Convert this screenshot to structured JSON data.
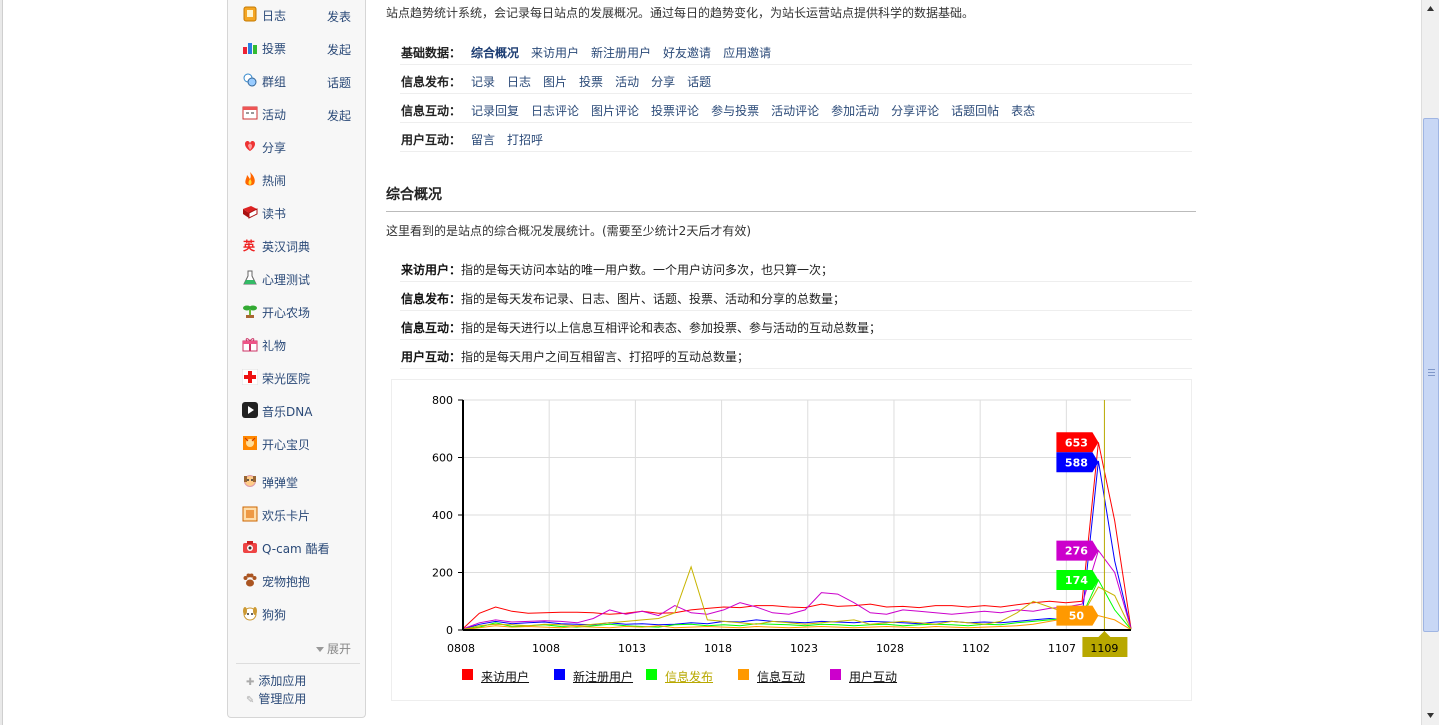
{
  "sidebar": {
    "items": [
      {
        "label": "日志",
        "action": "发表",
        "icon": "diary-icon"
      },
      {
        "label": "投票",
        "action": "发起",
        "icon": "vote-icon"
      },
      {
        "label": "群组",
        "action": "话题",
        "icon": "group-icon"
      },
      {
        "label": "活动",
        "action": "发起",
        "icon": "event-icon"
      },
      {
        "label": "分享",
        "action": "",
        "icon": "share-heart-icon"
      },
      {
        "label": "热闹",
        "action": "",
        "icon": "fire-icon"
      },
      {
        "label": "读书",
        "action": "",
        "icon": "book-icon"
      },
      {
        "label": "英汉词典",
        "action": "",
        "icon": "dictionary-icon"
      },
      {
        "label": "心理测试",
        "action": "",
        "icon": "flask-icon"
      },
      {
        "label": "开心农场",
        "action": "",
        "icon": "sprout-icon"
      },
      {
        "label": "礼物",
        "action": "",
        "icon": "gift-icon"
      },
      {
        "label": "荣光医院",
        "action": "",
        "icon": "hospital-cross-icon"
      },
      {
        "label": "音乐DNA",
        "action": "",
        "icon": "music-play-icon"
      },
      {
        "label": "开心宝贝",
        "action": "",
        "icon": "baby-icon"
      },
      {
        "label": "弹弹堂",
        "action": "",
        "icon": "dog-face-icon"
      },
      {
        "label": "欢乐卡片",
        "action": "",
        "icon": "card-icon"
      },
      {
        "label": "Q-cam 酷看",
        "action": "",
        "icon": "camera-icon"
      },
      {
        "label": "宠物抱抱",
        "action": "",
        "icon": "paw-icon"
      },
      {
        "label": "狗狗",
        "action": "",
        "icon": "puppy-icon"
      }
    ],
    "expand_label": "展开",
    "add_app": "添加应用",
    "manage_app": "管理应用"
  },
  "intro_text": "站点趋势统计系统，会记录每日站点的发展概况。通过每日的趋势变化，为站长运营站点提供科学的数据基础。",
  "nav_rows": [
    {
      "label": "基础数据：",
      "links": [
        "综合概况",
        "来访用户",
        "新注册用户",
        "好友邀请",
        "应用邀请"
      ]
    },
    {
      "label": "信息发布：",
      "links": [
        "记录",
        "日志",
        "图片",
        "投票",
        "活动",
        "分享",
        "话题"
      ]
    },
    {
      "label": "信息互动：",
      "links": [
        "记录回复",
        "日志评论",
        "图片评论",
        "投票评论",
        "参与投票",
        "活动评论",
        "参加活动",
        "分享评论",
        "话题回帖",
        "表态"
      ]
    },
    {
      "label": "用户互动：",
      "links": [
        "留言",
        "打招呼"
      ]
    }
  ],
  "section": {
    "title": "综合概况",
    "desc": "这里看到的是站点的综合概况发展统计。(需要至少统计2天后才有效)"
  },
  "definitions": [
    {
      "term": "来访用户：",
      "text": "指的是每天访问本站的唯一用户数。一个用户访问多次，也只算一次；"
    },
    {
      "term": "信息发布：",
      "text": "指的是每天发布记录、日志、图片、话题、投票、活动和分享的总数量；"
    },
    {
      "term": "信息互动：",
      "text": "指的是每天进行以上信息互相评论和表态、参加投票、参与活动的互动总数量；"
    },
    {
      "term": "用户互动：",
      "text": "指的是每天用户之间互相留言、打招呼的互动总数量；"
    }
  ],
  "chart_data": {
    "type": "line",
    "ylim": [
      0,
      800
    ],
    "yticks": [
      0,
      200,
      400,
      600,
      800
    ],
    "x_tick_labels": [
      "0808",
      "1008",
      "1013",
      "1018",
      "1023",
      "1028",
      "1102",
      "1107",
      "1109"
    ],
    "highlight_x_label": "1109",
    "grid": true,
    "legend_position": "bottom",
    "series": [
      {
        "name": "来访用户",
        "color": "#ff0000",
        "values": [
          5,
          58,
          80,
          65,
          58,
          60,
          62,
          62,
          60,
          55,
          58,
          65,
          58,
          60,
          70,
          75,
          80,
          78,
          85,
          85,
          80,
          78,
          90,
          82,
          85,
          90,
          80,
          82,
          78,
          85,
          85,
          80,
          85,
          80,
          88,
          95,
          100,
          95,
          100,
          653,
          380,
          5
        ]
      },
      {
        "name": "新注册用户",
        "color": "#0000ff",
        "values": [
          3,
          20,
          30,
          22,
          25,
          28,
          22,
          20,
          18,
          25,
          20,
          22,
          18,
          20,
          25,
          22,
          30,
          28,
          35,
          30,
          28,
          25,
          30,
          28,
          25,
          30,
          28,
          25,
          22,
          28,
          30,
          25,
          28,
          25,
          30,
          35,
          40,
          35,
          45,
          588,
          240,
          3
        ]
      },
      {
        "name": "信息发布",
        "color": "#00ff00",
        "values": [
          2,
          10,
          25,
          12,
          15,
          18,
          12,
          10,
          15,
          20,
          15,
          12,
          10,
          18,
          20,
          15,
          18,
          15,
          22,
          20,
          18,
          15,
          20,
          18,
          15,
          18,
          20,
          15,
          18,
          20,
          18,
          15,
          20,
          18,
          25,
          30,
          35,
          40,
          50,
          174,
          70,
          2
        ]
      },
      {
        "name": "信息互动",
        "color": "#ff9900",
        "values": [
          1,
          8,
          15,
          10,
          12,
          10,
          8,
          12,
          10,
          8,
          12,
          10,
          15,
          8,
          10,
          12,
          10,
          8,
          12,
          10,
          8,
          10,
          12,
          10,
          8,
          10,
          12,
          10,
          8,
          12,
          10,
          8,
          10,
          12,
          15,
          20,
          30,
          40,
          45,
          50,
          35,
          1
        ]
      },
      {
        "name": "用户互动",
        "color": "#cc00cc",
        "values": [
          4,
          25,
          35,
          28,
          30,
          32,
          30,
          25,
          40,
          70,
          55,
          65,
          50,
          85,
          60,
          55,
          70,
          95,
          80,
          60,
          55,
          70,
          130,
          125,
          95,
          60,
          55,
          70,
          65,
          60,
          55,
          60,
          65,
          60,
          70,
          65,
          75,
          80,
          90,
          276,
          200,
          4
        ]
      },
      {
        "name": "",
        "color": "#c8b400",
        "values": [
          2,
          15,
          20,
          18,
          15,
          20,
          18,
          15,
          20,
          25,
          30,
          35,
          40,
          60,
          220,
          35,
          30,
          25,
          20,
          30,
          25,
          20,
          25,
          30,
          35,
          20,
          25,
          30,
          25,
          20,
          30,
          25,
          20,
          30,
          60,
          100,
          80,
          60,
          50,
          150,
          120,
          2
        ]
      }
    ],
    "end_labels": [
      {
        "value": 653,
        "color": "#ff0000"
      },
      {
        "value": 588,
        "color": "#0000ff"
      },
      {
        "value": 276,
        "color": "#cc00cc"
      },
      {
        "value": 174,
        "color": "#00ff00"
      },
      {
        "value": 50,
        "color": "#ff9900"
      }
    ]
  },
  "colors": {
    "link": "#2b4a78",
    "olive": "#b8a800"
  }
}
